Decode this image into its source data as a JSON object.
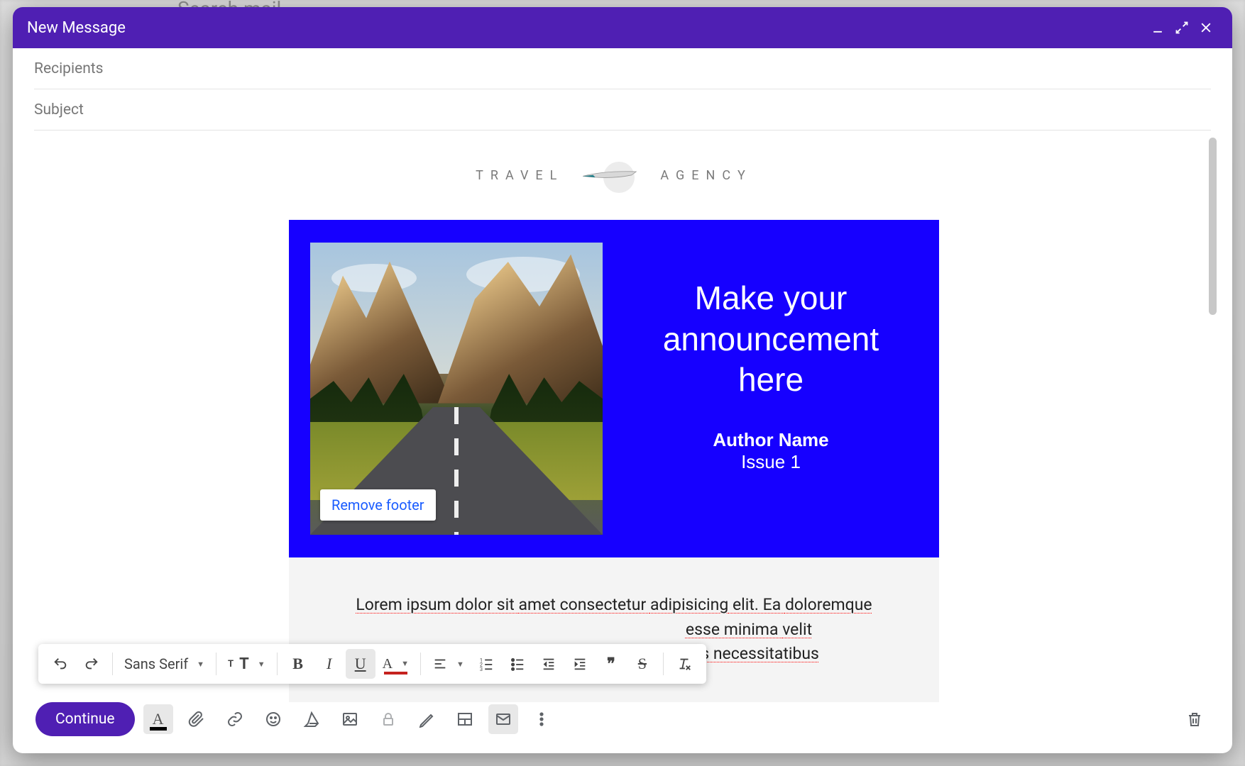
{
  "bg": {
    "search_hint": "Search mail"
  },
  "titlebar": {
    "title": "New Message"
  },
  "fields": {
    "recipients_placeholder": "Recipients",
    "subject_placeholder": "Subject"
  },
  "template": {
    "logo_left": "TRAVEL",
    "logo_right": "AGENCY",
    "remove_footer_label": "Remove footer",
    "announcement": "Make your announcement here",
    "author": "Author Name",
    "issue": "Issue 1",
    "lorem_line1_a": "Lorem ipsum dolor sit ",
    "lorem_line1_b": "amet",
    "lorem_line1_c": " ",
    "lorem_line1_d": "consectetur",
    "lorem_line1_e": " ",
    "lorem_line1_f": "adipisicing",
    "lorem_line1_g": " elit. Ea ",
    "lorem_line1_h": "doloremque",
    "lorem_line2_a": "esse minima ",
    "lorem_line2_b": "velit",
    "lorem_line3_a": "ibus ",
    "lorem_line3_b": "necessitatibus"
  },
  "format_toolbar": {
    "font_label": "Sans Serif"
  },
  "actions": {
    "send_label": "Continue"
  }
}
